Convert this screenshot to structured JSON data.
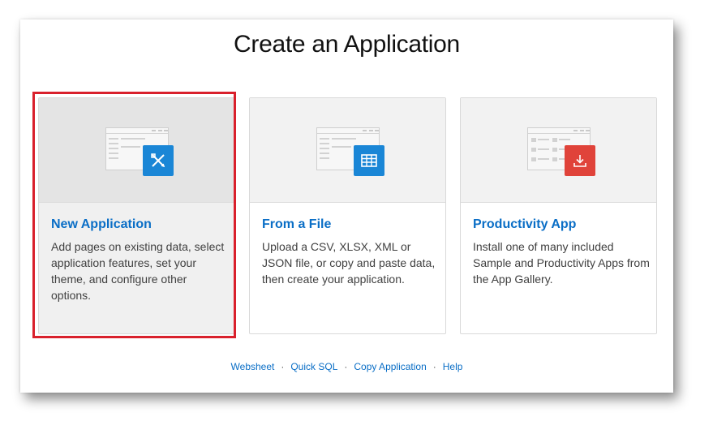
{
  "page": {
    "title": "Create an Application"
  },
  "cards": [
    {
      "title": "New Application",
      "description": "Add pages on existing data, select application features, set your theme, and configure other options.",
      "icon": "wrench-pencil-icon",
      "badge_color": "#1a86d6",
      "selected": true
    },
    {
      "title": "From a File",
      "description": "Upload a CSV, XLSX, XML or JSON file, or copy and paste data, then create your application.",
      "icon": "table-grid-icon",
      "badge_color": "#1a86d6",
      "selected": false
    },
    {
      "title": "Productivity App",
      "description": "Install one of many included Sample and Productivity Apps from the App Gallery.",
      "icon": "download-icon",
      "badge_color": "#e0433a",
      "selected": false
    }
  ],
  "footer": {
    "links": [
      "Websheet",
      "Quick SQL",
      "Copy Application",
      "Help"
    ],
    "separator": "·"
  },
  "colors": {
    "link": "#0a6ec6",
    "selection_outline": "#d9202c"
  }
}
